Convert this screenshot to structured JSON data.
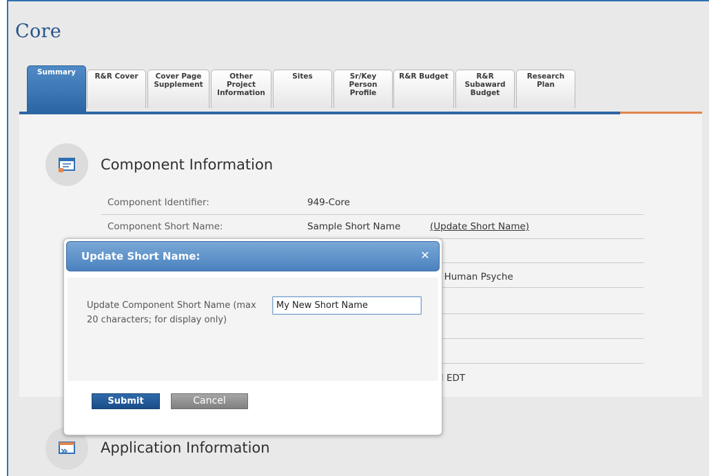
{
  "page": {
    "title": "Core"
  },
  "tabs": [
    {
      "label": "Summary",
      "active": true
    },
    {
      "label": "R&R Cover"
    },
    {
      "label": "Cover Page\nSupplement"
    },
    {
      "label": "Other\nProject\nInformation"
    },
    {
      "label": "Sites"
    },
    {
      "label": "Sr/Key\nPerson\nProfile"
    },
    {
      "label": "R&R Budget"
    },
    {
      "label": "R&R\nSubaward\nBudget"
    },
    {
      "label": "Research\nPlan"
    }
  ],
  "component_info": {
    "title": "Component Information",
    "icon": "document-icon",
    "rows": [
      {
        "label": "Component Identifier:",
        "value": "949-Core"
      },
      {
        "label": "Component Short Name:",
        "value": "Sample Short Name",
        "link": "(Update Short Name)"
      }
    ],
    "partial_values": {
      "title_fragment": "e Human Psyche",
      "time_fragment": "M EDT"
    }
  },
  "application_info": {
    "title": "Application Information",
    "icon": "application-icon"
  },
  "dialog": {
    "title": "Update Short Name:",
    "close_icon": "close-icon",
    "field_label": "Update Component Short Name (max 20 characters; for display only)",
    "field_value": "My New Short Name",
    "submit_label": "Submit",
    "cancel_label": "Cancel"
  },
  "colors": {
    "accent_blue": "#2d65a4",
    "accent_orange": "#e3854b",
    "title_blue": "#26548c"
  }
}
